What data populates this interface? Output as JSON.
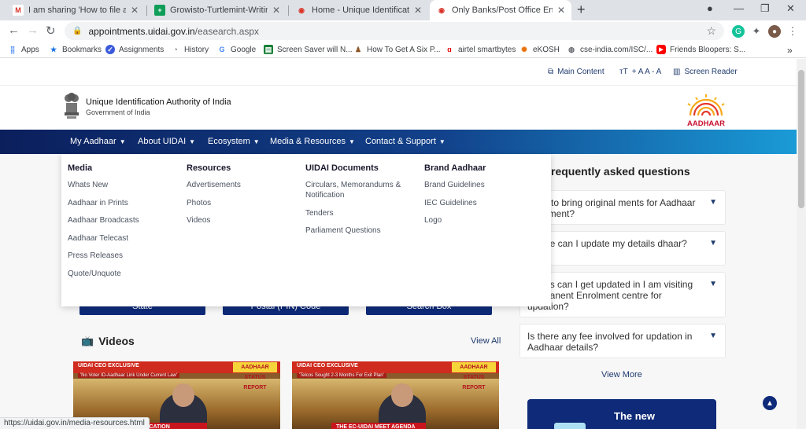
{
  "browser": {
    "tabs": [
      {
        "title": "I am sharing 'How to file a claim",
        "icon": "gmail-icon",
        "active": false
      },
      {
        "title": "Growisto-Turtlemint-Writing Sug",
        "icon": "sheets-icon",
        "active": false
      },
      {
        "title": "Home - Unique Identification Au",
        "icon": "uidai-icon",
        "active": false
      },
      {
        "title": "Only Banks/Post Office Enrolme",
        "icon": "uidai-icon",
        "active": true
      }
    ],
    "address": {
      "host": "appointments.uidai.gov.in",
      "path": "/easearch.aspx"
    },
    "bookmarks": [
      {
        "label": "Apps",
        "icon": "apps-grid-icon"
      },
      {
        "label": "Bookmarks",
        "icon": "star-icon"
      },
      {
        "label": "Assignments",
        "icon": "assignments-icon"
      },
      {
        "label": "History",
        "icon": "history-icon"
      },
      {
        "label": "Google",
        "icon": "google-icon"
      },
      {
        "label": "Screen Saver will N...",
        "icon": "document-icon"
      },
      {
        "label": "How To Get A Six P...",
        "icon": "fitness-icon"
      },
      {
        "label": "airtel smartbytes",
        "icon": "airtel-icon"
      },
      {
        "label": "eKOSH",
        "icon": "ekosh-icon"
      },
      {
        "label": "cse-india.com/ISC/...",
        "icon": "globe-icon"
      },
      {
        "label": "Friends Bloopers: S...",
        "icon": "youtube-icon"
      }
    ],
    "status_url": "https://uidai.gov.in/media-resources.html"
  },
  "site": {
    "utility": {
      "main_content": "Main Content",
      "text_size": "+ A A - A",
      "screen_reader": "Screen Reader"
    },
    "org_name": "Unique Identification Authority of India",
    "org_sub": "Government of India",
    "logo_text": "AADHAAR",
    "nav": [
      "My Aadhaar",
      "About UIDAI",
      "Ecosystem",
      "Media & Resources",
      "Contact & Support"
    ],
    "mega_menu": {
      "columns": [
        {
          "heading": "Media",
          "items": [
            "Whats New",
            "Aadhaar in Prints",
            "Aadhaar Broadcasts",
            "Aadhaar Telecast",
            "Press Releases",
            "Quote/Unquote"
          ]
        },
        {
          "heading": "Resources",
          "items": [
            "Advertisements",
            "Photos",
            "Videos"
          ]
        },
        {
          "heading": "UIDAI Documents",
          "items": [
            "Circulars, Memorandums & Notification",
            "Tenders",
            "Parliament Questions"
          ]
        },
        {
          "heading": "Brand Aadhaar",
          "items": [
            "Brand Guidelines",
            "IEC Guidelines",
            "Logo"
          ]
        }
      ]
    },
    "search_buttons": [
      "State",
      "Postal (PIN) Code",
      "Search Box"
    ],
    "videos": {
      "title": "Videos",
      "view_all": "View All",
      "items": [
        {
          "headline": "UIDAI CEO EXCLUSIVE",
          "sub": "'No Voter ID-Aadhaar Link Under Current Law'",
          "badge": "AADHAAR STATUS REPORT",
          "lower": "LINE VERIFICATION"
        },
        {
          "headline": "UIDAI CEO EXCLUSIVE",
          "sub": "'Telcos Sought 2-3 Months For Exit Plan'",
          "badge": "AADHAAR STATUS REPORT",
          "lower": "THE EC-UIDAI MEET AGENDA"
        }
      ]
    },
    "faq": {
      "title": "requently asked questions",
      "items": [
        "need to bring original ments for Aadhaar enrolment?",
        "Where can I update my details dhaar?",
        "details can I get updated in I am visiting Permanent Enrolment centre for updation?",
        "Is there any fee involved for updation in Aadhaar details?"
      ],
      "view_more": "View More"
    },
    "promo_title": "The new"
  }
}
